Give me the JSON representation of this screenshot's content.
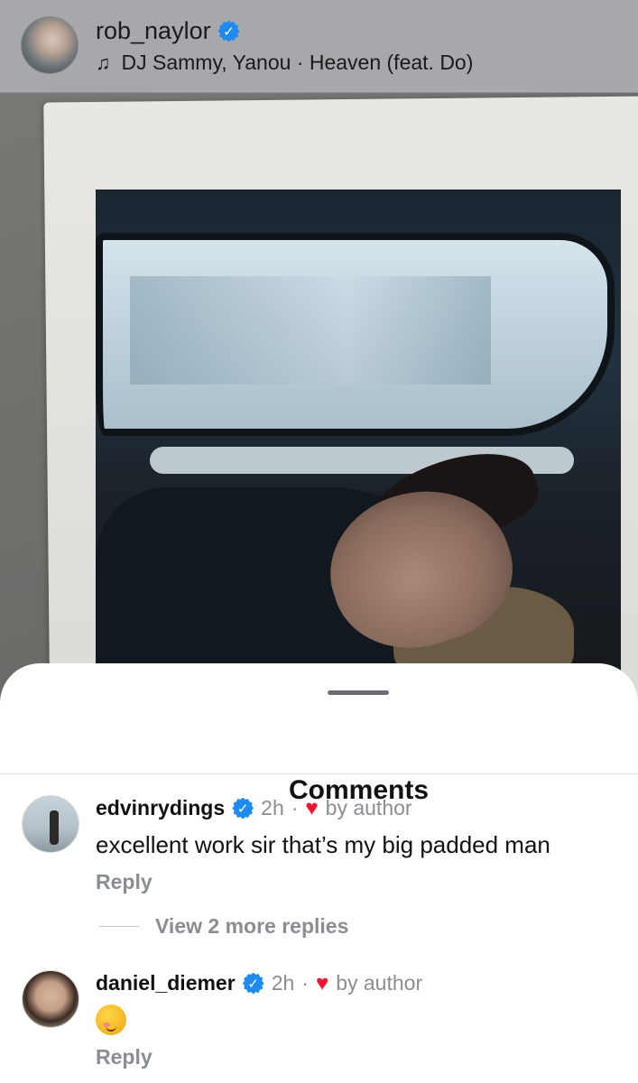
{
  "post": {
    "username": "rob_naylor",
    "music": "DJ Sammy, Yanou · Heaven (feat. Do)",
    "icons": {
      "verified": "verified-badge-icon",
      "music": "music-note-icon"
    }
  },
  "comments_sheet": {
    "title": "Comments",
    "comments": [
      {
        "username": "edvinrydings",
        "time": "2h",
        "separator": "·",
        "liked_by": "by author",
        "text": "excellent work sir that’s my big padded man",
        "reply_label": "Reply",
        "more_replies_label": "View 2 more replies"
      },
      {
        "username": "daniel_diemer",
        "time": "2h",
        "separator": "·",
        "liked_by": "by author",
        "text": "☺️",
        "reply_label": "Reply"
      }
    ]
  },
  "colors": {
    "verified": "#1d8bf1",
    "heart": "#f0142f",
    "muted_text": "#8a8d91"
  }
}
